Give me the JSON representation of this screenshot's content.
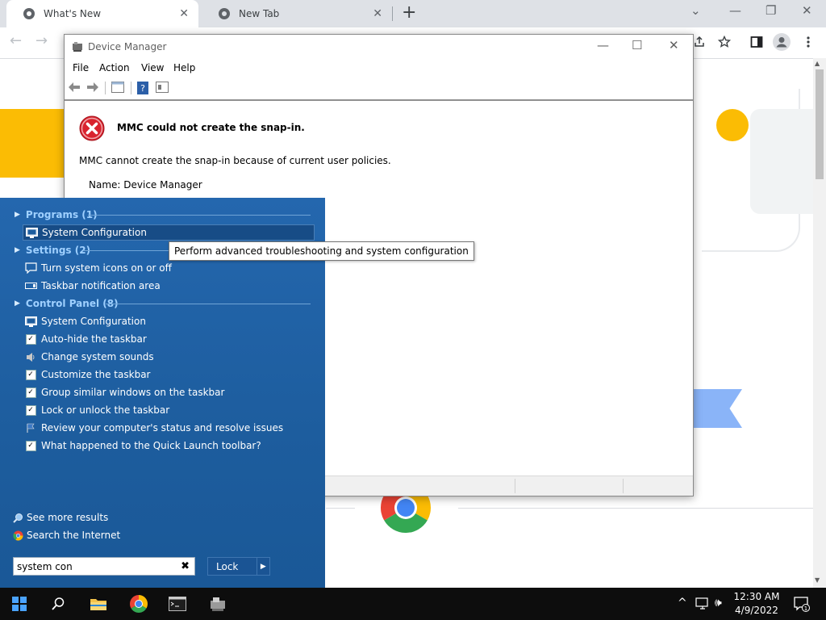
{
  "browser": {
    "tabs": [
      {
        "title": "What's New",
        "active": true
      },
      {
        "title": "New Tab",
        "active": false
      }
    ],
    "new_tab_symbol": "+",
    "close_symbol": "✕",
    "window_controls": {
      "dropdown": "⌄",
      "minimize": "—",
      "restore": "❐",
      "close": "✕"
    },
    "nav": {
      "back": "←",
      "forward": "→"
    },
    "toolbar_icons": [
      "share-icon",
      "star-icon",
      "sidebar-icon",
      "profile-icon",
      "menu-icon"
    ]
  },
  "device_manager": {
    "title": "Device Manager",
    "menu": [
      "File",
      "Action",
      "View",
      "Help"
    ],
    "error_title": "MMC could not create the snap-in.",
    "error_message": "MMC cannot create the snap-in because of current user policies.",
    "name_line": "Name: Device Manager",
    "controls": {
      "minimize": "—",
      "maximize": "☐",
      "close": "✕"
    }
  },
  "start_menu": {
    "sections": [
      {
        "header": "Programs (1)",
        "items": [
          {
            "label": "System Configuration",
            "icon": "sysconfig-icon",
            "selected": true
          }
        ]
      },
      {
        "header": "Settings (2)",
        "items": [
          {
            "label": "Turn system icons on or off",
            "icon": "speech-bubble-icon"
          },
          {
            "label": "Taskbar notification area",
            "icon": "taskbar-icon"
          }
        ]
      },
      {
        "header": "Control Panel (8)",
        "items": [
          {
            "label": "System Configuration",
            "icon": "sysconfig-icon"
          },
          {
            "label": "Auto-hide the taskbar",
            "icon": "checkbox-icon"
          },
          {
            "label": "Change system sounds",
            "icon": "speaker-icon"
          },
          {
            "label": "Customize the taskbar",
            "icon": "checkbox-icon"
          },
          {
            "label": "Group similar windows on the taskbar",
            "icon": "checkbox-icon"
          },
          {
            "label": "Lock or unlock the taskbar",
            "icon": "checkbox-icon"
          },
          {
            "label": "Review your computer's status and resolve issues",
            "icon": "flag-icon"
          },
          {
            "label": "What happened to the Quick Launch toolbar?",
            "icon": "checkbox-icon"
          }
        ]
      }
    ],
    "see_more": "See more results",
    "search_internet": "Search the Internet",
    "search_value": "system con",
    "search_clear": "✖",
    "lock_label": "Lock",
    "lock_arrow": "▶"
  },
  "tooltip": "Perform advanced troubleshooting and system configuration",
  "taskbar": {
    "time": "12:30 AM",
    "date": "4/9/2022",
    "tray": {
      "chevron": "^",
      "speaker": "🕪"
    },
    "notification_count": "1"
  },
  "colors": {
    "start_menu_bg": "#1d5d9e",
    "start_header": "#9fd0ff",
    "chrome_yellow": "#fbbc04",
    "error_red": "#d9232e"
  }
}
